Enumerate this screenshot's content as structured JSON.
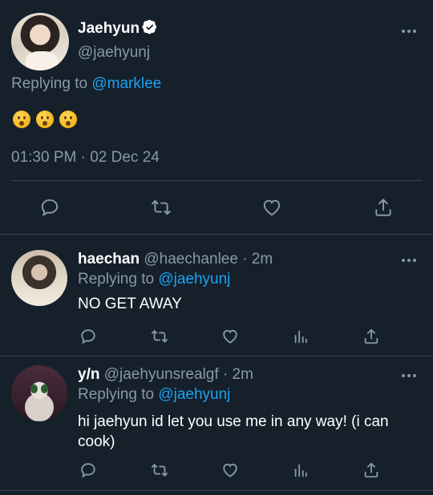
{
  "main_tweet": {
    "author_name": "Jaehyun",
    "author_handle": "@jaehyunj",
    "replying_label": "Replying to",
    "replying_to": "@marklee",
    "timestamp": "01:30 PM · 02 Dec 24"
  },
  "replies": [
    {
      "name": "haechan",
      "handle": "@haechanlee",
      "time": "· 2m",
      "replying_label": "Replying to",
      "replying_to": "@jaehyunj",
      "text": "NO GET AWAY"
    },
    {
      "name": "y/n",
      "handle": "@jaehyunsrealgf",
      "time": "· 2m",
      "replying_label": "Replying to",
      "replying_to": "@jaehyunj",
      "text_line1": "hi jaehyun id let you use me in any way! (i can",
      "text_line2": "cook)"
    }
  ],
  "colors": {
    "background": "#15202b",
    "accent": "#1da1f2",
    "muted": "#8899a6",
    "divider": "#38444d"
  }
}
